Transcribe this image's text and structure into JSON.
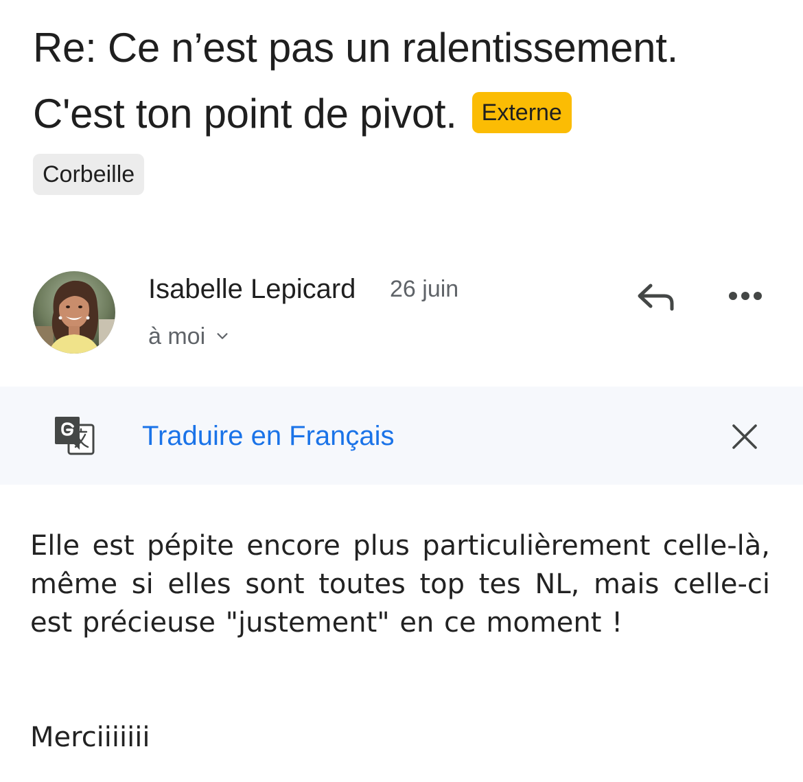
{
  "email": {
    "subject": "Re: Ce n’est pas un ralentissement. C'est ton point de pivot.",
    "external_badge": "Externe",
    "label_chip": "Corbeille"
  },
  "sender": {
    "name": "Isabelle Lepicard",
    "date": "26 juin",
    "recipient": "à moi",
    "avatar_icon": "user-photo-avatar"
  },
  "actions": {
    "reply_icon": "reply-arrow-icon",
    "more_icon": "more-horizontal-icon"
  },
  "translate": {
    "icon": "google-translate-icon",
    "link_label": "Traduire en Français",
    "close_icon": "close-icon"
  },
  "body": {
    "paragraph": "Elle est pépite encore plus particulièrement celle-là, même si elles sont toutes top tes NL, mais celle-ci est précieuse \"justement\" en ce moment !",
    "signoff": "Merciiiiiii"
  },
  "colors": {
    "badge_yellow": "#fbbc04",
    "chip_gray": "#ececec",
    "link_blue": "#1a73e8",
    "translate_bar_bg": "#f6f8fc",
    "secondary_text": "#5f6368"
  }
}
